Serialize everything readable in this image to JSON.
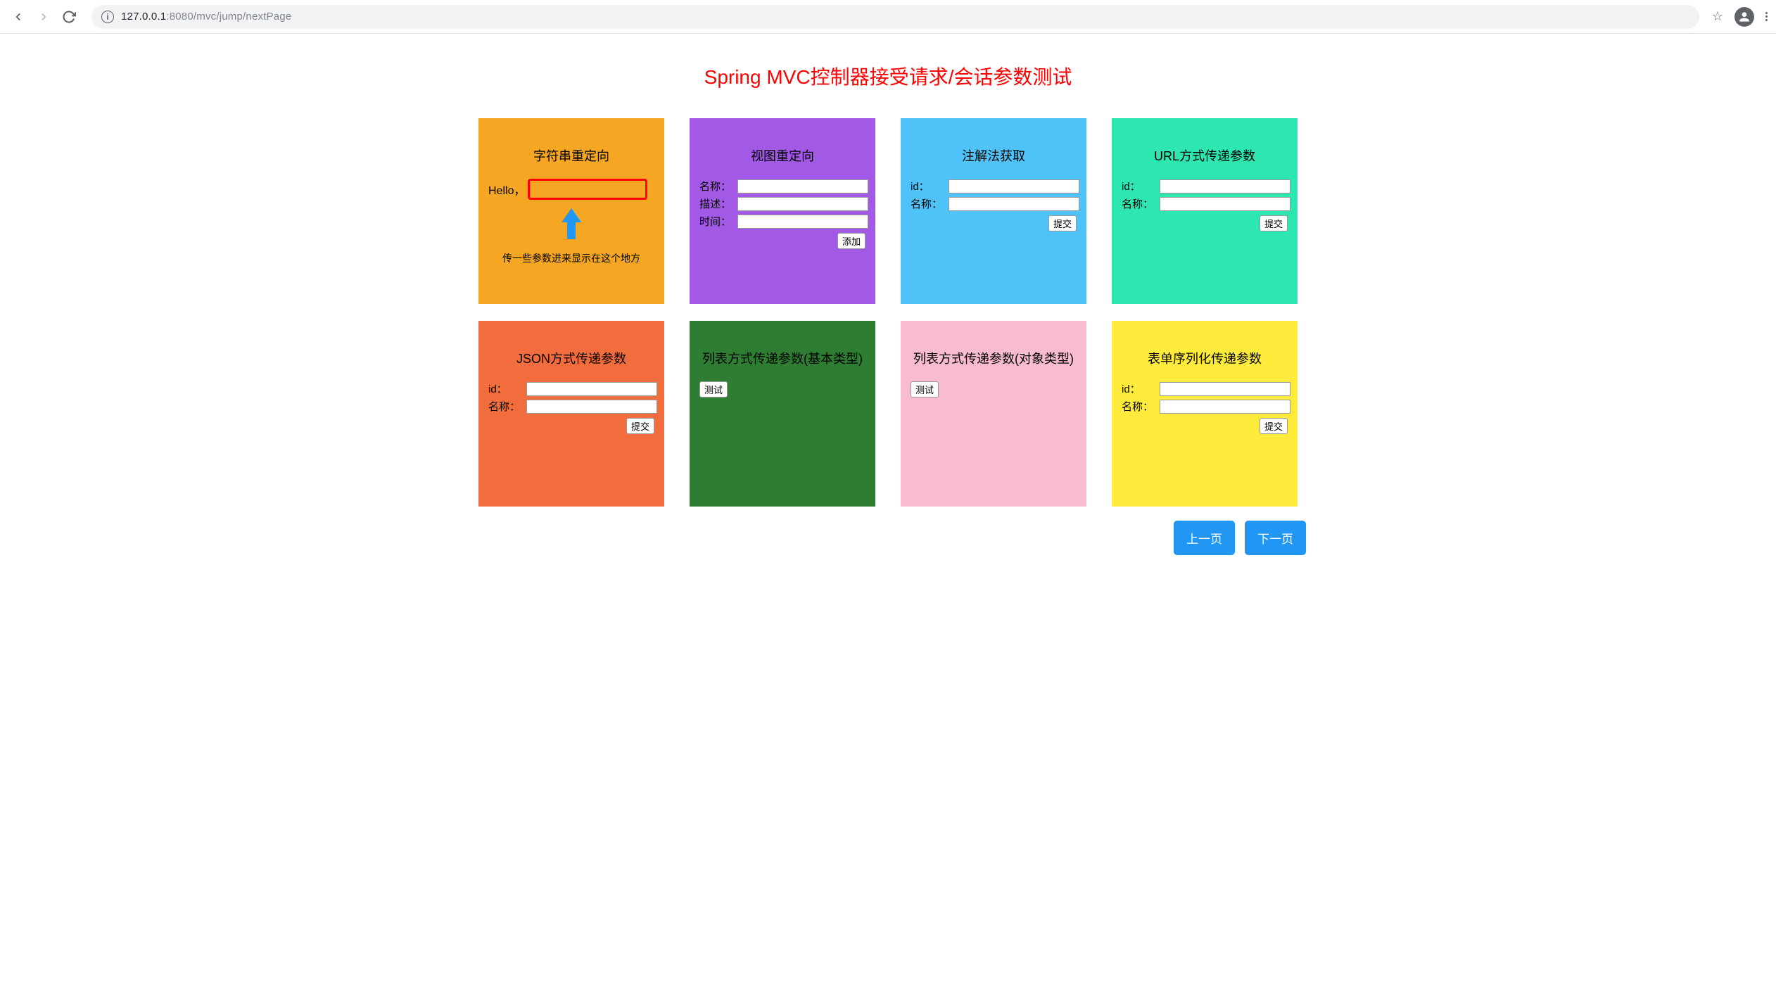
{
  "browser": {
    "url_host": "127.0.0.1",
    "url_rest": ":8080/mvc/jump/nextPage"
  },
  "page_title": "Spring MVC控制器接受请求/会话参数测试",
  "cards": {
    "c1": {
      "title": "字符串重定向",
      "hello": "Hello，",
      "caption": "传一些参数进来显示在这个地方"
    },
    "c2": {
      "title": "视图重定向",
      "name_label": "名称：",
      "desc_label": "描述：",
      "time_label": "时间：",
      "add_btn": "添加"
    },
    "c3": {
      "title": "注解法获取",
      "id_label": "id：",
      "name_label": "名称：",
      "submit_btn": "提交"
    },
    "c4": {
      "title": "URL方式传递参数",
      "id_label": "id：",
      "name_label": "名称：",
      "submit_btn": "提交"
    },
    "c5": {
      "title": "JSON方式传递参数",
      "id_label": "id：",
      "name_label": "名称：",
      "submit_btn": "提交"
    },
    "c6": {
      "title": "列表方式传递参数(基本类型)",
      "test_btn": "测试"
    },
    "c7": {
      "title": "列表方式传递参数(对象类型)",
      "test_btn": "测试"
    },
    "c8": {
      "title": "表单序列化传递参数",
      "id_label": "id：",
      "name_label": "名称：",
      "submit_btn": "提交"
    }
  },
  "nav": {
    "prev": "上一页",
    "next": "下一页"
  }
}
